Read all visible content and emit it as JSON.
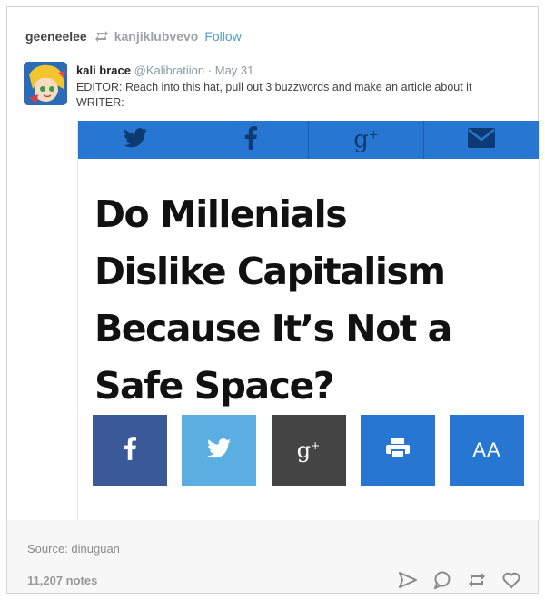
{
  "post": {
    "username": "geeneelee",
    "reblogged_from": "kanjiklubvevo",
    "follow_label": "Follow"
  },
  "tweet": {
    "name": "kali brace",
    "handle": "@Kalibratiion",
    "separator": "·",
    "date": "May 31",
    "line1": "EDITOR: Reach into this hat, pull out 3 buzzwords and make an article about it",
    "line2": "WRITER:"
  },
  "article": {
    "headline_lines": [
      "Do Millenials",
      "Dislike Capitalism",
      "Because It’s Not a",
      "Safe Space?"
    ],
    "share_top_icons": [
      "twitter-icon",
      "facebook-icon",
      "google-plus-icon",
      "mail-icon"
    ],
    "share_bottom": [
      {
        "icon": "facebook-icon",
        "color": "#3b5998"
      },
      {
        "icon": "twitter-icon",
        "color": "#5aaee2"
      },
      {
        "icon": "google-plus-icon",
        "color": "#444444"
      },
      {
        "icon": "print-icon",
        "color": "#2776d1"
      },
      {
        "icon": "font-size-icon",
        "label": "AA",
        "color": "#2776d1"
      }
    ]
  },
  "footer": {
    "source": "Source: dinuguan",
    "notes": "11,207 notes",
    "action_icons": [
      "share-icon",
      "reply-icon",
      "reblog-icon",
      "like-icon"
    ]
  },
  "colors": {
    "accent": "#529ecc",
    "share_blue": "#2776d1"
  }
}
